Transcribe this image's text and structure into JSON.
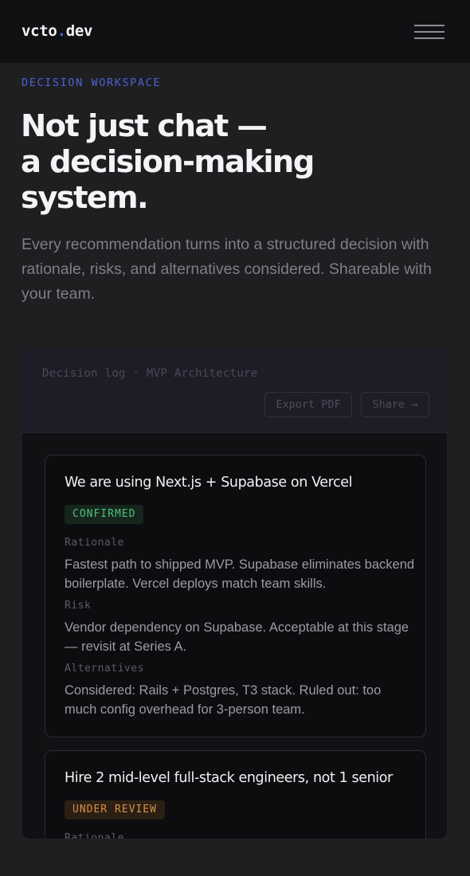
{
  "header": {
    "logo_prefix": "vcto",
    "logo_dot": ".",
    "logo_suffix": "dev",
    "menu_icon": "hamburger-menu-icon"
  },
  "hero": {
    "eyebrow": "DECISION WORKSPACE",
    "headline_lines": [
      "Not just chat —",
      "a decision-making",
      "system."
    ],
    "subtitle": "Every recommendation turns into a structured decision with rationale, risks, and alternatives considered. Shareable with your team."
  },
  "panel": {
    "title": "Decision log · MVP Architecture",
    "export_label": "Export PDF",
    "share_label": "Share →",
    "decisions": [
      {
        "title": "We are using Next.js + Supabase on Vercel",
        "status": "CONFIRMED",
        "rationale_label": "Rationale",
        "rationale": "Fastest path to shipped MVP. Supabase eliminates backend boilerplate. Vercel deploys match team skills.",
        "risk_label": "Risk",
        "risk": "Vendor dependency on Supabase. Acceptable at this stage — revisit at Series A.",
        "alternatives_label": "Alternatives",
        "alternatives": "Considered: Rails + Postgres, T3 stack. Ruled out: too much config overhead for 3-person team."
      },
      {
        "title": "Hire 2 mid-level full-stack engineers, not 1 senior",
        "status": "UNDER REVIEW",
        "rationale_label": "Rationale"
      }
    ]
  },
  "colors": {
    "accent": "#4a63d4",
    "confirmed": "#4fc07a",
    "under_review": "#d99048",
    "background": "#1f1e21"
  }
}
